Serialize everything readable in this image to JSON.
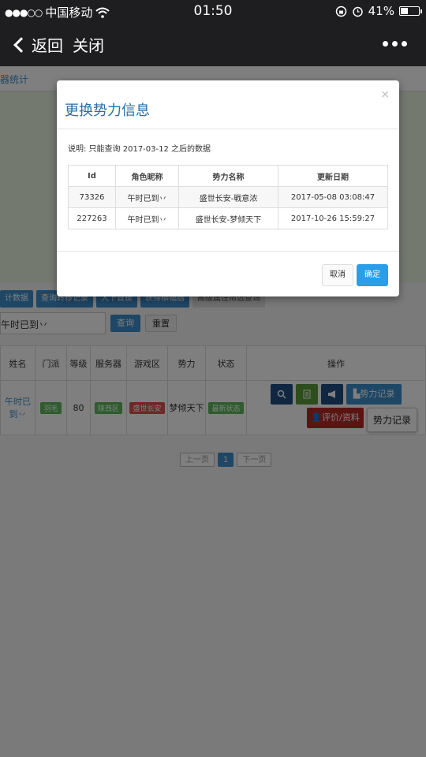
{
  "status_bar": {
    "signal": "●●●○○",
    "carrier": "中国移动",
    "time": "01:50",
    "battery": "41%",
    "battery_level": 0.41
  },
  "nav": {
    "back_label": "返回",
    "close_label": "关闭"
  },
  "page": {
    "title": "器统计",
    "buttons": [
      "计数据",
      "查询转移记录",
      "大下首拔",
      "获得横幅器",
      "高级属性筛选查询"
    ],
    "search_value": "午时已到丷",
    "query_label": "查询",
    "reset_label": "重置",
    "table": {
      "headers": [
        "姓名",
        "门派",
        "等级",
        "服务器",
        "游戏区",
        "势力",
        "状态",
        "操作"
      ],
      "row": {
        "name": "午时已到丷",
        "faction": "羽毛",
        "level": "80",
        "server": "陕西区",
        "zone": "盛世长安",
        "power": "梦倾天下",
        "status": "最新状态",
        "op_power_record": "势力记录",
        "op_review": "评价/资料",
        "tooltip": "势力记录"
      }
    },
    "pager": {
      "prev": "上一页",
      "current": "1",
      "next": "下一页"
    }
  },
  "modal": {
    "title": "更换势力信息",
    "close": "×",
    "note": "说明: 只能查询 2017-03-12 之后的数据",
    "headers": [
      "Id",
      "角色昵称",
      "势力名称",
      "更新日期"
    ],
    "rows": [
      {
        "id": "73326",
        "nickname": "午时已到丷",
        "power": "盛世长安-戦意浓",
        "date": "2017-05-08 03:08:47"
      },
      {
        "id": "227263",
        "nickname": "午时已到丷",
        "power": "盛世长安-梦倾天下",
        "date": "2017-10-26 15:59:27"
      }
    ],
    "cancel_label": "取消",
    "ok_label": "确定"
  }
}
